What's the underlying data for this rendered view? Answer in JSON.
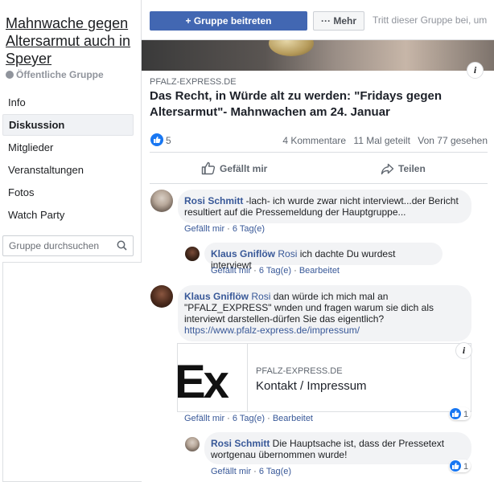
{
  "sidebar": {
    "group_title": "Mahnwache gegen Altersarmut auch in Speyer",
    "group_type": "Öffentliche Gruppe",
    "nav": [
      "Info",
      "Diskussion",
      "Mitglieder",
      "Veranstaltungen",
      "Fotos",
      "Watch Party"
    ],
    "active_nav": "Diskussion",
    "search_placeholder": "Gruppe durchsuchen"
  },
  "topbar": {
    "join_label": "Gruppe beitreten",
    "more_label": "Mehr",
    "hint": "Tritt dieser Gruppe bei, um"
  },
  "post": {
    "link_domain": "PFALZ-EXPRESS.DE",
    "link_title": "Das Recht, in Würde alt zu werden: \"Fridays gegen Altersarmut\"- Mahnwachen am 24. Januar",
    "like_count": "5",
    "comments": "4 Kommentare",
    "shares": "11 Mal geteilt",
    "seen": "Von 77 gesehen",
    "like_label": "Gefällt mir",
    "share_label": "Teilen"
  },
  "comments": [
    {
      "author": "Rosi Schmitt",
      "text": " -lach- ich wurde zwar nicht interviewt...der Bericht resultiert auf die Pressemeldung der Hauptgruppe...",
      "like": "Gefällt mir",
      "time": "6 Tag(e)"
    },
    {
      "author": "Klaus Gniflöw",
      "mention": "Rosi",
      "text": " ich dachte Du wurdest interviewt",
      "like": "Gefällt mir",
      "time": "6 Tag(e)",
      "edited": "Bearbeitet"
    },
    {
      "author": "Klaus Gniflöw",
      "mention": "Rosi",
      "text": " dan würde ich mich mal an \"PFALZ_EXPRESS\" wnden und fragen warum sie dich als interviewt darstellen-dürfen Sie das eigentlich?",
      "url": "https://www.pfalz-express.de/impressum/",
      "preview_domain": "PFALZ-EXPRESS.DE",
      "preview_title": "Kontakt / Impressum",
      "preview_logo": "Ex",
      "like": "Gefällt mir",
      "time": "6 Tag(e)",
      "edited": "Bearbeitet",
      "reactions": "1"
    },
    {
      "author": "Rosi Schmitt",
      "text": " Die Hauptsache ist, dass der Pressetext wortgenau übernommen wurde!",
      "like": "Gefällt mir",
      "time": "6 Tag(e)",
      "reactions": "1"
    }
  ],
  "colors": {
    "accent": "#4267b2",
    "link": "#385898",
    "like_blue": "#1877f2"
  }
}
